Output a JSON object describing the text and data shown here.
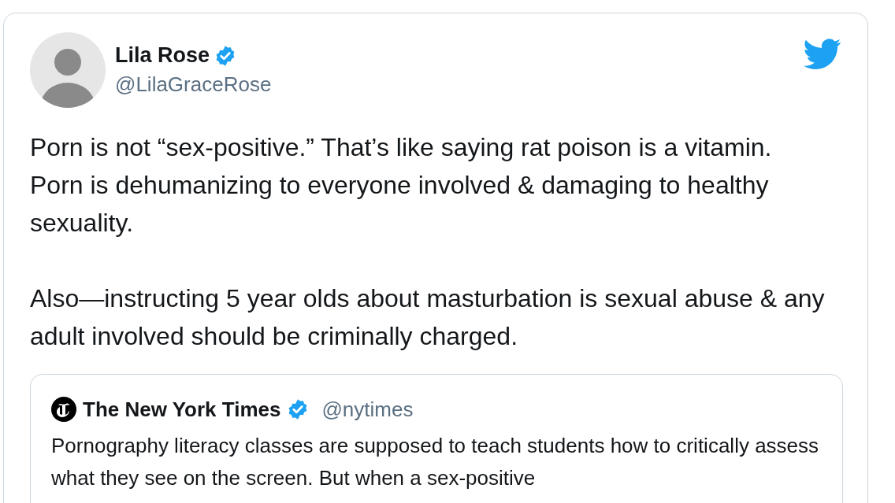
{
  "tweet": {
    "author": {
      "name": "Lila Rose",
      "verified": true,
      "handle": "@LilaGraceRose"
    },
    "paragraphs": [
      "Porn is not “sex-positive.” That’s like saying rat poison is a vitamin. Porn is dehumanizing to everyone involved & damaging to healthy sexuality.",
      "Also—instructing 5 year olds about masturbation is sexual abuse & any adult involved should be criminally charged."
    ],
    "quoted_tweet": {
      "author": {
        "name": "The New York Times",
        "verified": true,
        "handle": "@nytimes"
      },
      "text": "Pornography literacy classes are supposed to teach students how to critically assess what they see on the screen. But when a sex-positive"
    }
  }
}
